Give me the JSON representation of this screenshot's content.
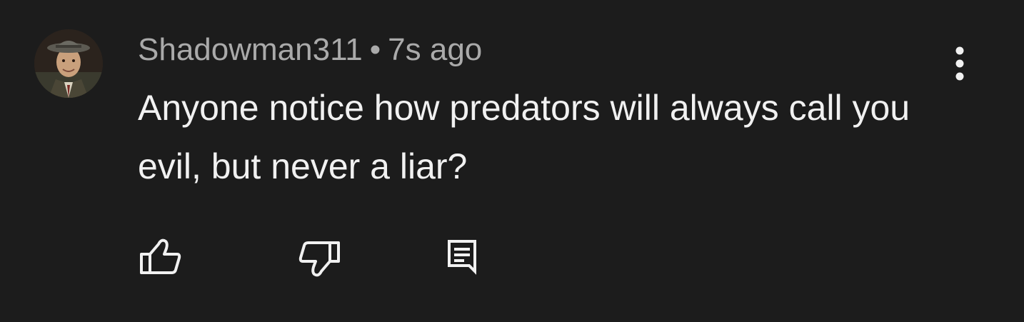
{
  "comment": {
    "author": "Shadowman311",
    "separator": "•",
    "timestamp": "7s ago",
    "text": "Anyone notice how predators will always call you evil, but never a liar?"
  },
  "actions": {
    "like_icon": "thumbs-up-icon",
    "dislike_icon": "thumbs-down-icon",
    "reply_icon": "reply-comment-icon",
    "more_icon": "more-vertical-icon"
  },
  "colors": {
    "background": "#1c1c1c",
    "primary_text": "#f1f1f1",
    "secondary_text": "#aaaaaa"
  }
}
